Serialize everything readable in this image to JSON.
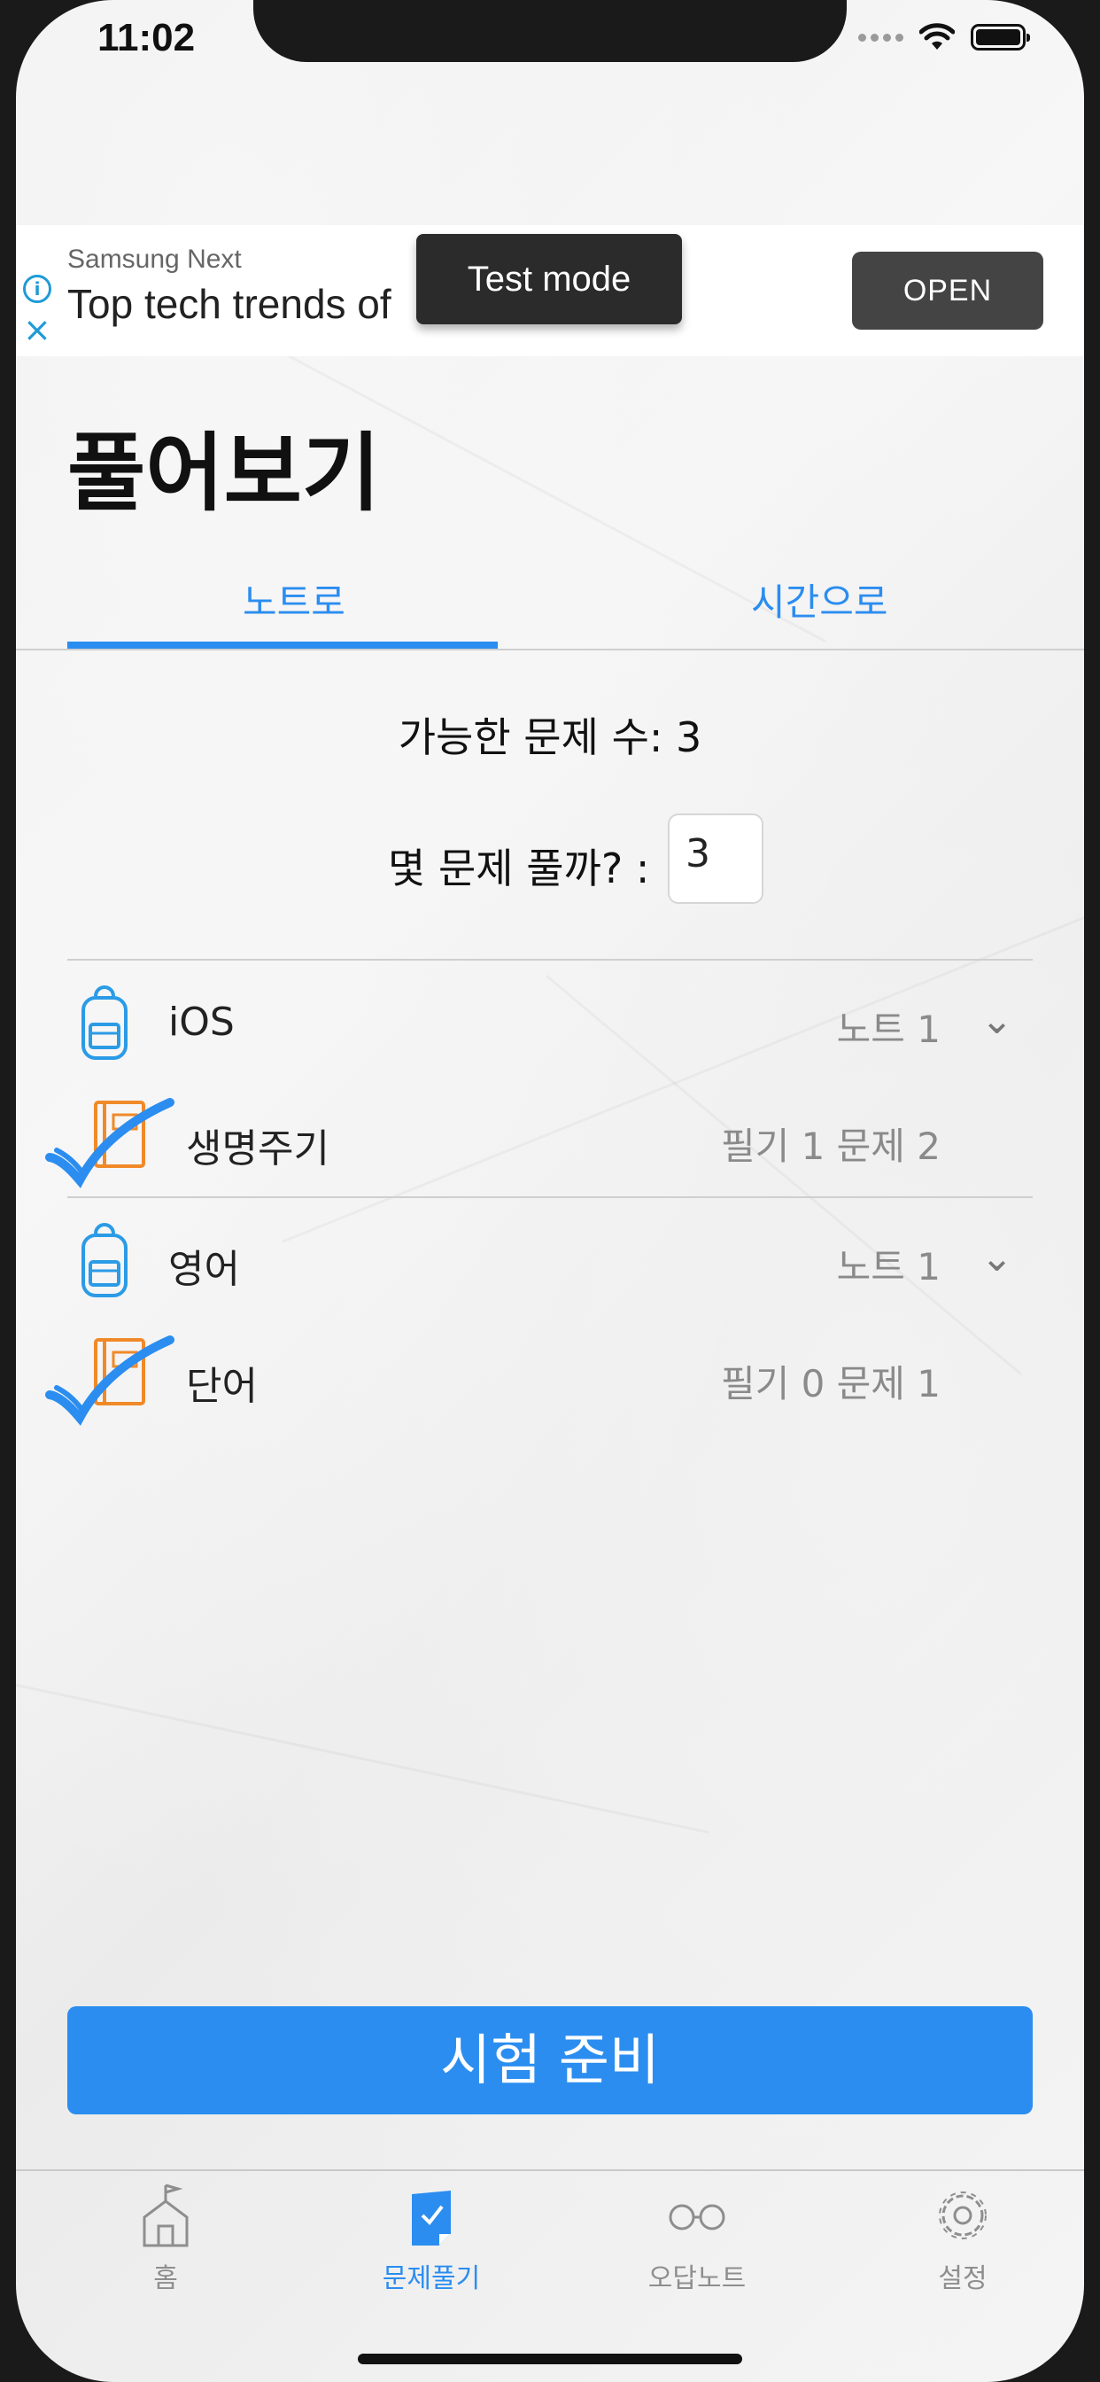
{
  "status_bar": {
    "time": "11:02"
  },
  "ad_banner": {
    "advertiser": "Samsung Next",
    "headline": "Top tech trends of",
    "cta": "OPEN",
    "test_mode": "Test mode"
  },
  "page": {
    "title": "풀어보기"
  },
  "tabs": [
    {
      "label": "노트로",
      "selected": true
    },
    {
      "label": "시간으로",
      "selected": false
    }
  ],
  "summary": {
    "available_label": "가능한 문제 수:  3",
    "question_prompt": "몇 문제 풀까? :",
    "question_count": "3"
  },
  "notes": [
    {
      "title": "iOS",
      "count_text": "노트 1",
      "sections": [
        {
          "title": "생명주기",
          "meta": "필기 1  문제 2",
          "checked": true
        }
      ]
    },
    {
      "title": "영어",
      "count_text": "노트 1",
      "sections": [
        {
          "title": "단어",
          "meta": "필기 0  문제 1",
          "checked": true
        }
      ]
    }
  ],
  "primary_action": {
    "label": "시험 준비"
  },
  "tab_bar": [
    {
      "label": "홈",
      "icon": "home-icon",
      "active": false
    },
    {
      "label": "문제풀기",
      "icon": "document-check-icon",
      "active": true
    },
    {
      "label": "오답노트",
      "icon": "glasses-icon",
      "active": false
    },
    {
      "label": "설정",
      "icon": "gear-icon",
      "active": false
    }
  ],
  "colors": {
    "accent": "#2b8df0",
    "ad_button": "#444444",
    "backpack": "#2b9be6",
    "notebook": "#f08a28"
  }
}
